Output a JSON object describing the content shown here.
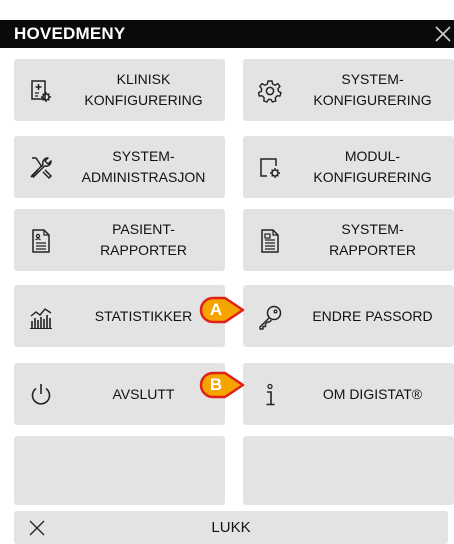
{
  "header": {
    "title": "HOVEDMENY"
  },
  "tiles": [
    {
      "label": "KLINISK\nKONFIGURERING",
      "icon": "clinical-config-icon"
    },
    {
      "label": "SYSTEM-\nKONFIGURERING",
      "icon": "gear-icon"
    },
    {
      "label": "SYSTEM-\nADMINISTRASJON",
      "icon": "tools-icon"
    },
    {
      "label": "MODUL-\nKONFIGURERING",
      "icon": "module-config-icon"
    },
    {
      "label": "PASIENT-\nRAPPORTER",
      "icon": "patient-report-icon"
    },
    {
      "label": "SYSTEM-\nRAPPORTER",
      "icon": "system-report-icon"
    },
    {
      "label": "STATISTIKKER",
      "icon": "statistics-icon"
    },
    {
      "label": "ENDRE PASSORD",
      "icon": "key-icon"
    },
    {
      "label": "AVSLUTT",
      "icon": "power-icon"
    },
    {
      "label": "OM DIGISTAT®",
      "icon": "info-icon"
    },
    {
      "label": "",
      "icon": ""
    },
    {
      "label": "",
      "icon": ""
    }
  ],
  "callouts": [
    {
      "letter": "A"
    },
    {
      "letter": "B"
    }
  ],
  "footer": {
    "close_label": "LUKK"
  },
  "colors": {
    "header_bg": "#0a0a0a",
    "tile_bg": "#e3e3e3",
    "callout_fill": "#f5a400",
    "callout_border": "#e0201a"
  }
}
